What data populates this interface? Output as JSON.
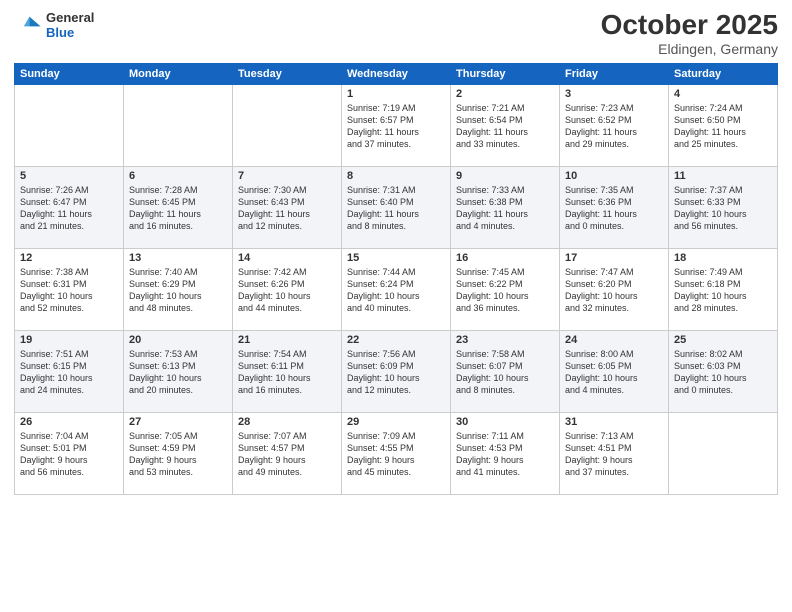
{
  "header": {
    "logo_general": "General",
    "logo_blue": "Blue",
    "month": "October 2025",
    "location": "Eldingen, Germany"
  },
  "weekdays": [
    "Sunday",
    "Monday",
    "Tuesday",
    "Wednesday",
    "Thursday",
    "Friday",
    "Saturday"
  ],
  "weeks": [
    [
      {
        "day": "",
        "info": ""
      },
      {
        "day": "",
        "info": ""
      },
      {
        "day": "",
        "info": ""
      },
      {
        "day": "1",
        "info": "Sunrise: 7:19 AM\nSunset: 6:57 PM\nDaylight: 11 hours\nand 37 minutes."
      },
      {
        "day": "2",
        "info": "Sunrise: 7:21 AM\nSunset: 6:54 PM\nDaylight: 11 hours\nand 33 minutes."
      },
      {
        "day": "3",
        "info": "Sunrise: 7:23 AM\nSunset: 6:52 PM\nDaylight: 11 hours\nand 29 minutes."
      },
      {
        "day": "4",
        "info": "Sunrise: 7:24 AM\nSunset: 6:50 PM\nDaylight: 11 hours\nand 25 minutes."
      }
    ],
    [
      {
        "day": "5",
        "info": "Sunrise: 7:26 AM\nSunset: 6:47 PM\nDaylight: 11 hours\nand 21 minutes."
      },
      {
        "day": "6",
        "info": "Sunrise: 7:28 AM\nSunset: 6:45 PM\nDaylight: 11 hours\nand 16 minutes."
      },
      {
        "day": "7",
        "info": "Sunrise: 7:30 AM\nSunset: 6:43 PM\nDaylight: 11 hours\nand 12 minutes."
      },
      {
        "day": "8",
        "info": "Sunrise: 7:31 AM\nSunset: 6:40 PM\nDaylight: 11 hours\nand 8 minutes."
      },
      {
        "day": "9",
        "info": "Sunrise: 7:33 AM\nSunset: 6:38 PM\nDaylight: 11 hours\nand 4 minutes."
      },
      {
        "day": "10",
        "info": "Sunrise: 7:35 AM\nSunset: 6:36 PM\nDaylight: 11 hours\nand 0 minutes."
      },
      {
        "day": "11",
        "info": "Sunrise: 7:37 AM\nSunset: 6:33 PM\nDaylight: 10 hours\nand 56 minutes."
      }
    ],
    [
      {
        "day": "12",
        "info": "Sunrise: 7:38 AM\nSunset: 6:31 PM\nDaylight: 10 hours\nand 52 minutes."
      },
      {
        "day": "13",
        "info": "Sunrise: 7:40 AM\nSunset: 6:29 PM\nDaylight: 10 hours\nand 48 minutes."
      },
      {
        "day": "14",
        "info": "Sunrise: 7:42 AM\nSunset: 6:26 PM\nDaylight: 10 hours\nand 44 minutes."
      },
      {
        "day": "15",
        "info": "Sunrise: 7:44 AM\nSunset: 6:24 PM\nDaylight: 10 hours\nand 40 minutes."
      },
      {
        "day": "16",
        "info": "Sunrise: 7:45 AM\nSunset: 6:22 PM\nDaylight: 10 hours\nand 36 minutes."
      },
      {
        "day": "17",
        "info": "Sunrise: 7:47 AM\nSunset: 6:20 PM\nDaylight: 10 hours\nand 32 minutes."
      },
      {
        "day": "18",
        "info": "Sunrise: 7:49 AM\nSunset: 6:18 PM\nDaylight: 10 hours\nand 28 minutes."
      }
    ],
    [
      {
        "day": "19",
        "info": "Sunrise: 7:51 AM\nSunset: 6:15 PM\nDaylight: 10 hours\nand 24 minutes."
      },
      {
        "day": "20",
        "info": "Sunrise: 7:53 AM\nSunset: 6:13 PM\nDaylight: 10 hours\nand 20 minutes."
      },
      {
        "day": "21",
        "info": "Sunrise: 7:54 AM\nSunset: 6:11 PM\nDaylight: 10 hours\nand 16 minutes."
      },
      {
        "day": "22",
        "info": "Sunrise: 7:56 AM\nSunset: 6:09 PM\nDaylight: 10 hours\nand 12 minutes."
      },
      {
        "day": "23",
        "info": "Sunrise: 7:58 AM\nSunset: 6:07 PM\nDaylight: 10 hours\nand 8 minutes."
      },
      {
        "day": "24",
        "info": "Sunrise: 8:00 AM\nSunset: 6:05 PM\nDaylight: 10 hours\nand 4 minutes."
      },
      {
        "day": "25",
        "info": "Sunrise: 8:02 AM\nSunset: 6:03 PM\nDaylight: 10 hours\nand 0 minutes."
      }
    ],
    [
      {
        "day": "26",
        "info": "Sunrise: 7:04 AM\nSunset: 5:01 PM\nDaylight: 9 hours\nand 56 minutes."
      },
      {
        "day": "27",
        "info": "Sunrise: 7:05 AM\nSunset: 4:59 PM\nDaylight: 9 hours\nand 53 minutes."
      },
      {
        "day": "28",
        "info": "Sunrise: 7:07 AM\nSunset: 4:57 PM\nDaylight: 9 hours\nand 49 minutes."
      },
      {
        "day": "29",
        "info": "Sunrise: 7:09 AM\nSunset: 4:55 PM\nDaylight: 9 hours\nand 45 minutes."
      },
      {
        "day": "30",
        "info": "Sunrise: 7:11 AM\nSunset: 4:53 PM\nDaylight: 9 hours\nand 41 minutes."
      },
      {
        "day": "31",
        "info": "Sunrise: 7:13 AM\nSunset: 4:51 PM\nDaylight: 9 hours\nand 37 minutes."
      },
      {
        "day": "",
        "info": ""
      }
    ]
  ]
}
